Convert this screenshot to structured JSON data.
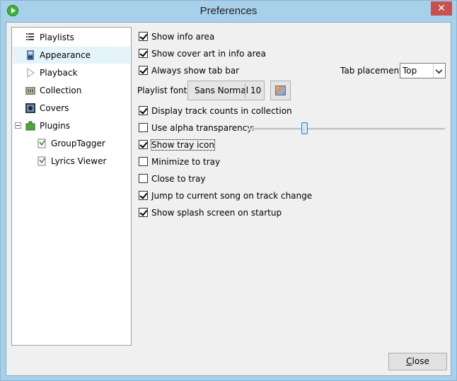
{
  "window": {
    "title": "Preferences",
    "close_glyph": "✕"
  },
  "sidebar": {
    "items": [
      {
        "label": "Playlists",
        "icon": "playlist-icon"
      },
      {
        "label": "Appearance",
        "icon": "appearance-icon",
        "selected": true
      },
      {
        "label": "Playback",
        "icon": "play-icon"
      },
      {
        "label": "Collection",
        "icon": "collection-icon"
      },
      {
        "label": "Covers",
        "icon": "covers-icon"
      },
      {
        "label": "Plugins",
        "icon": "plugins-icon",
        "expanded": true
      },
      {
        "label": "GroupTagger",
        "icon": "plugin-item-icon"
      },
      {
        "label": "Lyrics Viewer",
        "icon": "plugin-item-icon"
      }
    ]
  },
  "options": {
    "show_info_area": {
      "label": "Show info area",
      "checked": true
    },
    "show_cover_art": {
      "label": "Show cover art in info area",
      "checked": true
    },
    "always_show_tab_bar": {
      "label": "Always show tab bar",
      "checked": true
    },
    "display_track_counts": {
      "label": "Display track counts in collection",
      "checked": true
    },
    "use_alpha": {
      "label": "Use alpha transparency:",
      "checked": false
    },
    "show_tray_icon": {
      "label": "Show tray icon",
      "checked": true
    },
    "minimize_to_tray": {
      "label": "Minimize to tray",
      "checked": false
    },
    "close_to_tray": {
      "label": "Close to tray",
      "checked": false
    },
    "jump_to_song": {
      "label": "Jump to current song on track change",
      "checked": true
    },
    "show_splash": {
      "label": "Show splash screen on startup",
      "checked": true
    }
  },
  "tab_placement": {
    "label": "Tab placement:",
    "value": "Top"
  },
  "playlist_font": {
    "label": "Playlist font:",
    "name": "Sans Normal",
    "size": "10"
  },
  "alpha_slider": {
    "fraction": 0.28
  },
  "buttons": {
    "close_label_prefix": "",
    "close_mnemonic": "C",
    "close_label_rest": "lose"
  },
  "colors": {
    "title_bar": "#a7d1ea",
    "selected_item": "#e5f3fb",
    "close_x": "#c75050"
  }
}
